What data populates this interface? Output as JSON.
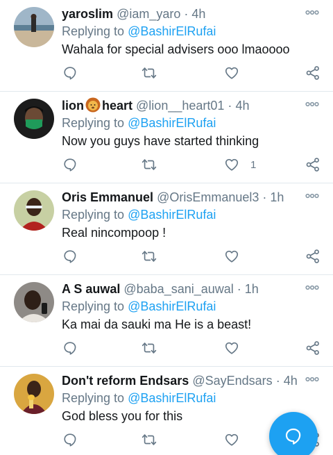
{
  "tweets": [
    {
      "name": "yaroslim",
      "handle": "@iam_yaro",
      "separator": "·",
      "time": "4h",
      "replying_prefix": "Replying to ",
      "replying_to": "@BashirElRufai",
      "text": "Wahala for special advisers ooo lmaoooo",
      "like_count": "",
      "avatar_icon": "beach-photo-avatar"
    },
    {
      "name": "lion",
      "name_suffix": "heart",
      "name_emoji": "lion-emoji",
      "handle": "@lion__heart01",
      "separator": "·",
      "time": "4h",
      "replying_prefix": "Replying to ",
      "replying_to": "@BashirElRufai",
      "text": "Now you guys have started thinking",
      "like_count": "1",
      "avatar_icon": "masked-woman-avatar"
    },
    {
      "name": "Oris Emmanuel",
      "handle": "@OrisEmmanuel3",
      "separator": "·",
      "time": "1h",
      "replying_prefix": "Replying to ",
      "replying_to": "@BashirElRufai",
      "text": "Real nincompoop !",
      "like_count": "",
      "avatar_icon": "man-portrait-avatar"
    },
    {
      "name": "A S auwal",
      "handle": "@baba_sani_auwal",
      "separator": "·",
      "time": "1h",
      "replying_prefix": "Replying to ",
      "replying_to": "@BashirElRufai",
      "text": "Ka mai da sauki ma He is a beast!",
      "like_count": "",
      "avatar_icon": "man-selfie-avatar"
    },
    {
      "name": "Don't reform Endsars",
      "handle": "@SayEndsars",
      "separator": "·",
      "time": "4h",
      "replying_prefix": "Replying to ",
      "replying_to": "@BashirElRufai",
      "text": "God bless you for this",
      "like_count": "",
      "avatar_icon": "basketball-player-avatar"
    }
  ],
  "colors": {
    "accent": "#1da1f2",
    "secondary_text": "#657786",
    "primary_text": "#14171a",
    "divider": "#e1e8ed"
  },
  "fab": {
    "icon": "new-message-icon"
  }
}
